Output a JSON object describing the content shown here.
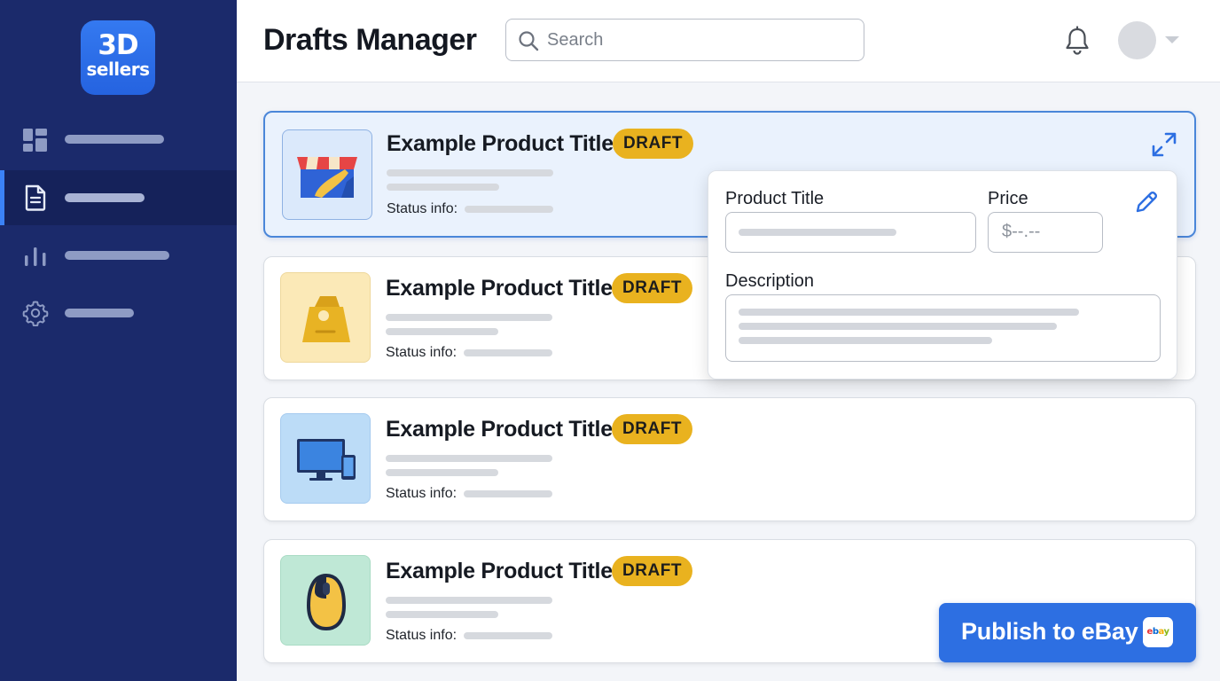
{
  "app": {
    "logo_line1": "3D",
    "logo_line2": "sellers",
    "brand_color": "#2563e0",
    "sidebar_color": "#1b2a6b"
  },
  "sidebar": {
    "items": [
      {
        "icon": "dashboard-icon",
        "active": false
      },
      {
        "icon": "document-icon",
        "active": true
      },
      {
        "icon": "bar-chart-icon",
        "active": false
      },
      {
        "icon": "gear-icon",
        "active": false
      }
    ]
  },
  "header": {
    "title": "Drafts Manager",
    "search_placeholder": "Search",
    "notifications_icon": "bell-icon",
    "avatar_icon": "avatar"
  },
  "drafts": [
    {
      "title": "Example Product Title",
      "badge": "DRAFT",
      "status_label": "Status info:",
      "thumb_icon": "storefront-icon",
      "thumb_color": "#dbe9fb",
      "selected": true
    },
    {
      "title": "Example Product Title",
      "badge": "DRAFT",
      "status_label": "Status info:",
      "thumb_icon": "shopping-bag-icon",
      "thumb_color": "#fbe9b7",
      "selected": false
    },
    {
      "title": "Example Product Title",
      "badge": "DRAFT",
      "status_label": "Status info:",
      "thumb_icon": "computer-devices-icon",
      "thumb_color": "#bcdcf7",
      "selected": false
    },
    {
      "title": "Example Product Title",
      "badge": "DRAFT",
      "status_label": "Status info:",
      "thumb_icon": "computer-mouse-icon",
      "thumb_color": "#bfe8d6",
      "selected": false
    }
  ],
  "editor": {
    "title_label": "Product Title",
    "price_label": "Price",
    "price_placeholder": "$--.--",
    "description_label": "Description",
    "edit_icon": "pencil-icon",
    "expand_icon": "expand-icon"
  },
  "publish": {
    "label": "Publish to eBay",
    "logo_text": "ebay",
    "color": "#2d6fe2"
  },
  "badge_color": "#e9b21f"
}
